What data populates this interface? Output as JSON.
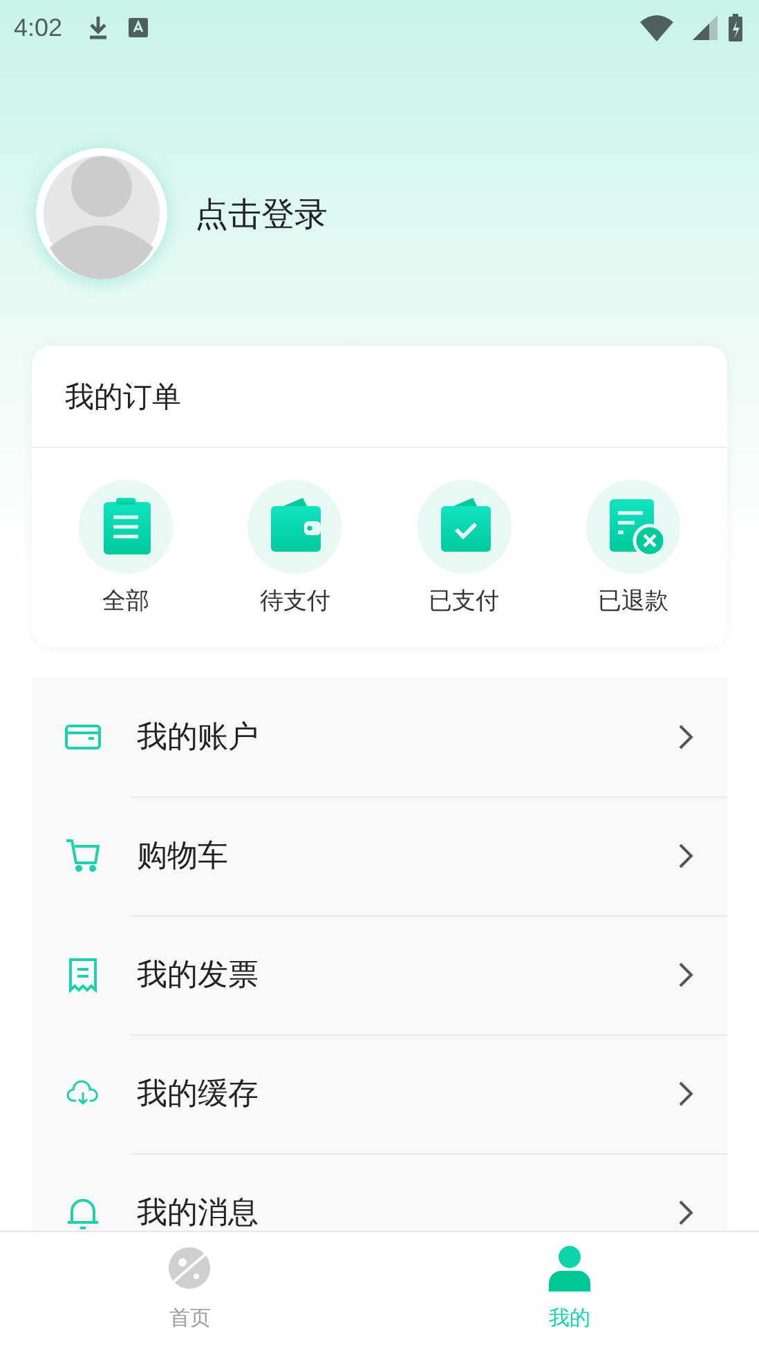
{
  "status_bar": {
    "time": "4:02"
  },
  "profile": {
    "login_text": "点击登录"
  },
  "orders": {
    "title": "我的订单",
    "items": [
      {
        "kind": "clipboard",
        "label": "全部"
      },
      {
        "kind": "wallet",
        "label": "待支付"
      },
      {
        "kind": "paid",
        "label": "已支付"
      },
      {
        "kind": "refund",
        "label": "已退款"
      }
    ]
  },
  "menu": [
    {
      "kind": "card",
      "label": "我的账户"
    },
    {
      "kind": "cart",
      "label": "购物车"
    },
    {
      "kind": "receipt",
      "label": "我的发票"
    },
    {
      "kind": "cloud",
      "label": "我的缓存"
    },
    {
      "kind": "bell",
      "label": "我的消息"
    }
  ],
  "tab_bar": [
    {
      "kind": "home",
      "label": "首页",
      "selected": false
    },
    {
      "kind": "me",
      "label": "我的",
      "selected": true
    }
  ]
}
